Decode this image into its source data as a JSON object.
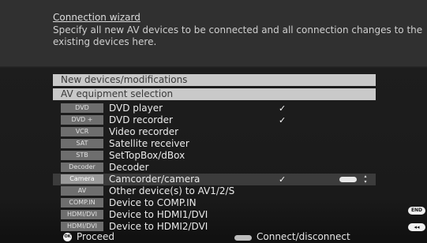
{
  "header": {
    "title": "Connection wizard",
    "description": "Specify all new AV devices to be connected and all connection changes to the existing devices here."
  },
  "sections": {
    "new_devices": "New devices/modifications",
    "av_selection": "AV equipment selection"
  },
  "devices": [
    {
      "tag": "DVD",
      "name": "DVD player",
      "checked": true
    },
    {
      "tag": "DVD +",
      "name": "DVD recorder",
      "checked": true
    },
    {
      "tag": "VCR",
      "name": "Video recorder",
      "checked": false
    },
    {
      "tag": "SAT",
      "name": "Satellite receiver",
      "checked": false
    },
    {
      "tag": "STB",
      "name": "SetTopBox/dBox",
      "checked": false
    },
    {
      "tag": "Decoder",
      "name": "Decoder",
      "checked": false
    },
    {
      "tag": "Camera",
      "name": "Camcorder/camera",
      "checked": true,
      "selected": true
    },
    {
      "tag": "AV",
      "name": "Other device(s) to AV1/2/S",
      "checked": false
    },
    {
      "tag": "COMP.IN",
      "name": "Device to COMP.IN",
      "checked": false
    },
    {
      "tag": "HDMI/DVI",
      "name": "Device to HDMI1/DVI",
      "checked": false
    },
    {
      "tag": "HDMI/DVI",
      "name": "Device to HDMI2/DVI",
      "checked": false
    }
  ],
  "side_buttons": {
    "end": "END",
    "back": "◂◂"
  },
  "footer": {
    "ok_icon": "OK",
    "proceed": "Proceed",
    "connect": "Connect/disconnect"
  },
  "colors": {
    "header_bg": "#303030",
    "section_bar": "#c9c9c9",
    "tag_bg": "#6e6e6e",
    "selected_row": "#3c3c3c"
  }
}
